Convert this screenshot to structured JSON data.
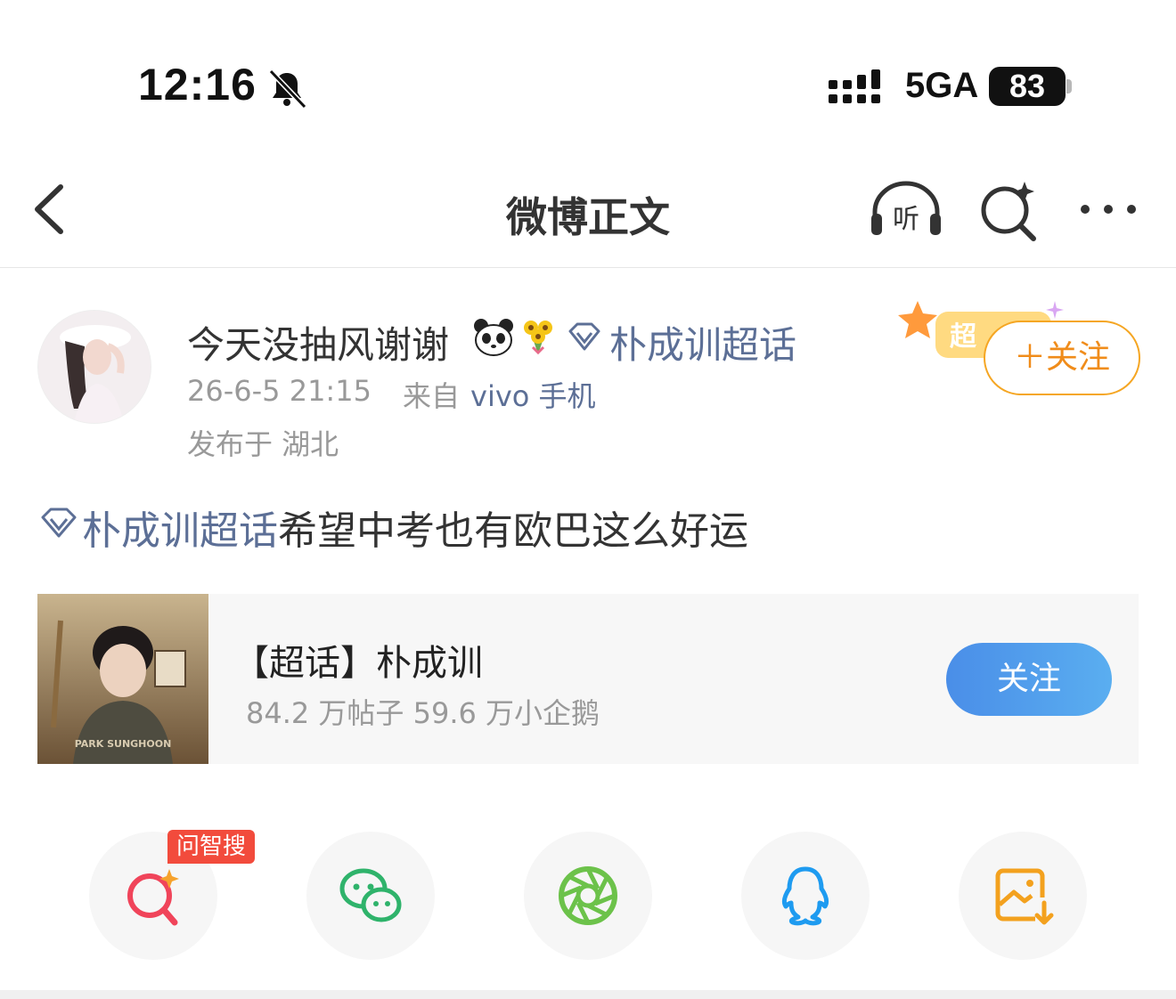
{
  "status_bar": {
    "time": "12:16",
    "network": "5GA",
    "battery": "83"
  },
  "nav": {
    "title": "微博正文",
    "listen_label": "听"
  },
  "post": {
    "username": "今天没抽风谢谢",
    "topic": "朴成训超话",
    "time": "26-6-5 21:15",
    "from_label": "来自",
    "device": "vivo 手机",
    "location": "发布于 湖北",
    "badge_text": "超",
    "follow_label": "＋关注",
    "content_topic": "朴成训超话",
    "content_text": "希望中考也有欧巴这么好运"
  },
  "topic_card": {
    "title": "【超话】朴成训",
    "stats": "84.2 万帖子 59.6 万小企鹅",
    "follow_label": "关注",
    "thumb_text": "PARK SUNGHOON"
  },
  "share": {
    "ai_tag": "问智搜",
    "items": [
      "ai-search",
      "wechat",
      "moments",
      "qq",
      "save-image"
    ]
  },
  "colors": {
    "link": "#5c6f96",
    "follow_orange": "#f08c1a",
    "follow_blue": "#4a8ee8",
    "ai_red": "#f24b3c"
  }
}
